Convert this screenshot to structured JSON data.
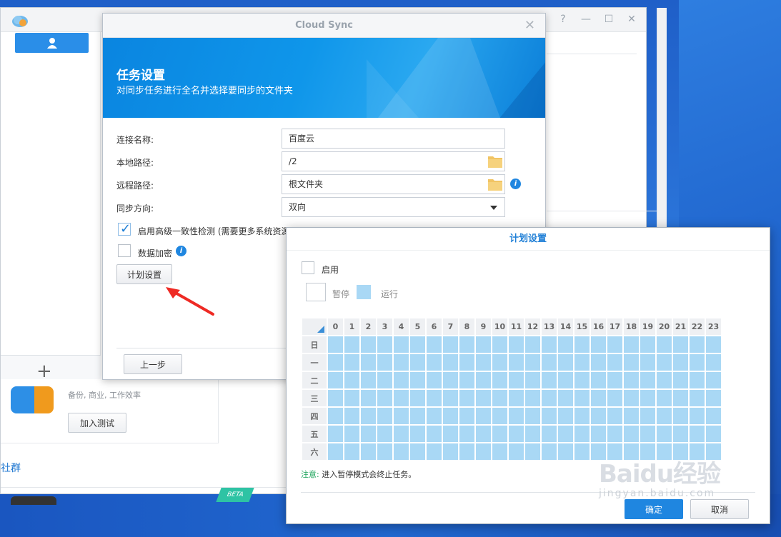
{
  "back_window": {
    "package_desc": "备份, 商业, 工作效率",
    "join_button": "加入测试",
    "community_link": "社群",
    "beta_tag": "BETA",
    "window_controls": [
      "?",
      "—",
      "☐",
      "✕"
    ]
  },
  "cloud_sync": {
    "title": "Cloud Sync",
    "banner_title": "任务设置",
    "banner_subtitle": "对同步任务进行全名并选择要同步的文件夹",
    "fields": {
      "connection_name_label": "连接名称:",
      "connection_name_value": "百度云",
      "local_path_label": "本地路径:",
      "local_path_value": "/2",
      "remote_path_label": "远程路径:",
      "remote_path_value": "根文件夹",
      "sync_direction_label": "同步方向:",
      "sync_direction_value": "双向"
    },
    "advanced_check_label": "启用高级一致性检测 (需要更多系统资源",
    "advanced_checked": true,
    "encrypt_label": "数据加密",
    "encrypt_checked": false,
    "schedule_button": "计划设置",
    "prev_button": "上一步"
  },
  "plan_dialog": {
    "title": "计划设置",
    "enable_label": "启用",
    "enable_checked": false,
    "legend_pause": "暂停",
    "legend_run": "运行",
    "hours": [
      "0",
      "1",
      "2",
      "3",
      "4",
      "5",
      "6",
      "7",
      "8",
      "9",
      "10",
      "11",
      "12",
      "13",
      "14",
      "15",
      "16",
      "17",
      "18",
      "19",
      "20",
      "21",
      "22",
      "23"
    ],
    "days": [
      "日",
      "一",
      "二",
      "三",
      "四",
      "五",
      "六"
    ],
    "note_key": "注意:",
    "note_text": "进入暂停模式会终止任务。",
    "ok_button": "确定",
    "cancel_button": "取消",
    "run_color": "#a9d8f5"
  },
  "watermark": {
    "main": "Baidu经验",
    "sub": "jingyan.baidu.com"
  }
}
